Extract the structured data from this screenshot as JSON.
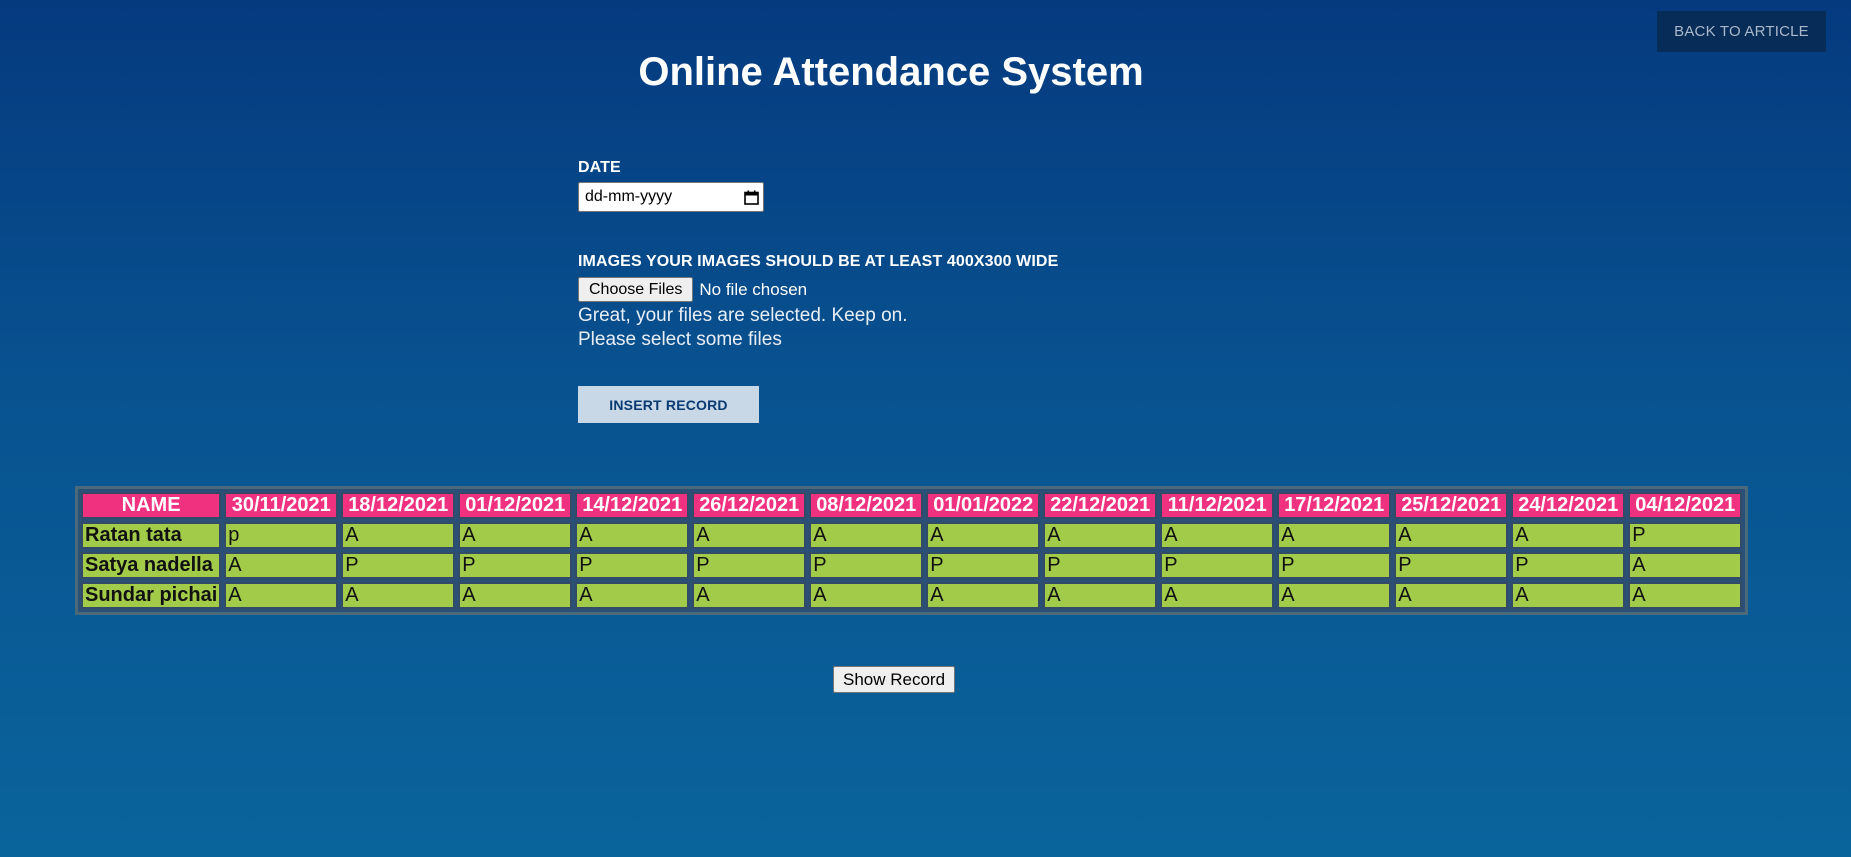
{
  "header": {
    "back_label": "BACK TO ARTICLE",
    "title": "Online Attendance System"
  },
  "form": {
    "date_label": "DATE",
    "date_placeholder": "dd-mm-yyyy",
    "images_label": "IMAGES YOUR IMAGES SHOULD BE AT LEAST 400X300 WIDE",
    "choose_files_label": "Choose Files",
    "no_file_text": "No file chosen",
    "message_selected": "Great, your files are selected. Keep on.",
    "message_select": "Please select some files",
    "insert_label": "INSERT RECORD"
  },
  "table": {
    "headers": [
      "NAME",
      "30/11/2021",
      "18/12/2021",
      "01/12/2021",
      "14/12/2021",
      "26/12/2021",
      "08/12/2021",
      "01/01/2022",
      "22/12/2021",
      "11/12/2021",
      "17/12/2021",
      "25/12/2021",
      "24/12/2021",
      "04/12/2021"
    ],
    "rows": [
      [
        "Ratan tata",
        "p",
        "A",
        "A",
        "A",
        "A",
        "A",
        "A",
        "A",
        "A",
        "A",
        "A",
        "A",
        "P"
      ],
      [
        "Satya nadella",
        "A",
        "P",
        "P",
        "P",
        "P",
        "P",
        "P",
        "P",
        "P",
        "P",
        "P",
        "P",
        "A"
      ],
      [
        "Sundar pichai",
        "A",
        "A",
        "A",
        "A",
        "A",
        "A",
        "A",
        "A",
        "A",
        "A",
        "A",
        "A",
        "A"
      ]
    ]
  },
  "show_record_label": "Show Record",
  "colors": {
    "background_top": "#053a7f",
    "background_bottom": "#0a649c",
    "header_cell": "#f0317f",
    "data_cell": "#a2cb4a",
    "back_button": "#072c58",
    "insert_button": "#c8d8e6"
  }
}
